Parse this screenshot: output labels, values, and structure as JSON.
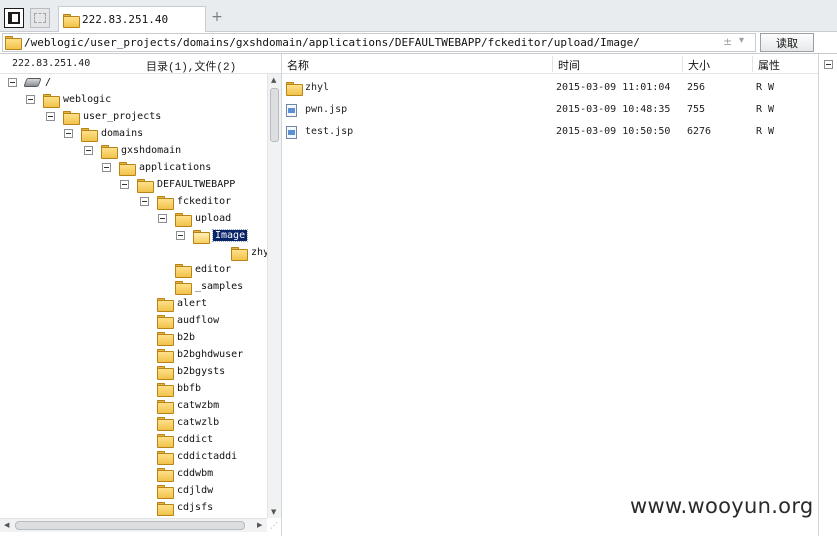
{
  "tab": {
    "title": "222.83.251.40",
    "add_label": "+"
  },
  "address": {
    "path": "/weblogic/user_projects/domains/gxshdomain/applications/DEFAULTWEBAPP/fckeditor/upload/Image/",
    "pm_symbol": "±",
    "dropdown_symbol": "▾",
    "read_button": "读取"
  },
  "left": {
    "ip": "222.83.251.40",
    "count_label": "目录(1),文件(2)"
  },
  "tree": [
    {
      "label": "/",
      "icon": "drive-icon",
      "expander": true
    },
    {
      "label": "weblogic",
      "icon": "folder-icon",
      "expander": true
    },
    {
      "label": "user_projects",
      "icon": "folder-icon",
      "expander": true
    },
    {
      "label": "domains",
      "icon": "folder-icon",
      "expander": true
    },
    {
      "label": "gxshdomain",
      "icon": "folder-icon",
      "expander": true
    },
    {
      "label": "applications",
      "icon": "folder-icon",
      "expander": true
    },
    {
      "label": "DEFAULTWEBAPP",
      "icon": "folder-icon",
      "expander": true
    },
    {
      "label": "fckeditor",
      "icon": "folder-icon",
      "expander": true
    },
    {
      "label": "upload",
      "icon": "folder-icon",
      "expander": true
    },
    {
      "label": "Image",
      "icon": "folder-open-icon",
      "expander": true,
      "selected": true
    },
    {
      "label": "zhyl",
      "icon": "folder-icon",
      "expander": false
    },
    {
      "label": "editor",
      "icon": "folder-icon",
      "expander": false
    },
    {
      "label": "_samples",
      "icon": "folder-icon",
      "expander": false
    },
    {
      "label": "alert",
      "icon": "folder-icon",
      "expander": false
    },
    {
      "label": "audflow",
      "icon": "folder-icon",
      "expander": false
    },
    {
      "label": "b2b",
      "icon": "folder-icon",
      "expander": false
    },
    {
      "label": "b2bghdwuser",
      "icon": "folder-icon",
      "expander": false
    },
    {
      "label": "b2bgysts",
      "icon": "folder-icon",
      "expander": false
    },
    {
      "label": "bbfb",
      "icon": "folder-icon",
      "expander": false
    },
    {
      "label": "catwzbm",
      "icon": "folder-icon",
      "expander": false
    },
    {
      "label": "catwzlb",
      "icon": "folder-icon",
      "expander": false
    },
    {
      "label": "cddict",
      "icon": "folder-icon",
      "expander": false
    },
    {
      "label": "cddictaddi",
      "icon": "folder-icon",
      "expander": false
    },
    {
      "label": "cddwbm",
      "icon": "folder-icon",
      "expander": false
    },
    {
      "label": "cdjldw",
      "icon": "folder-icon",
      "expander": false
    },
    {
      "label": "cdjsfs",
      "icon": "folder-icon",
      "expander": false
    }
  ],
  "list": {
    "headers": {
      "name": "名称",
      "time": "时间",
      "size": "大小",
      "attr": "属性"
    },
    "rows": [
      {
        "name": "zhyl",
        "icon": "folder-icon",
        "time": "2015-03-09 11:01:04",
        "size": "256",
        "attr": "R W"
      },
      {
        "name": "pwn.jsp",
        "icon": "file-icon",
        "time": "2015-03-09 10:48:35",
        "size": "755",
        "attr": "R W"
      },
      {
        "name": "test.jsp",
        "icon": "file-icon",
        "time": "2015-03-09 10:50:50",
        "size": "6276",
        "attr": "R W"
      }
    ]
  },
  "watermark": "www.wooyun.org"
}
